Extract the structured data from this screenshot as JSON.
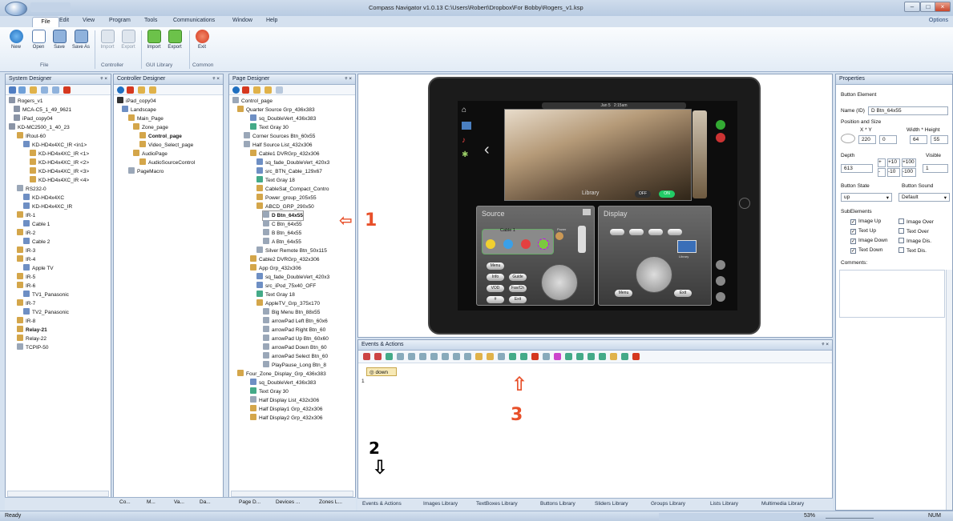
{
  "window": {
    "title": "Compass Navigator v1.0.13 C:\\Users\\Robert\\Dropbox\\For Bobby\\Rogers_v1.ksp",
    "options": "Options"
  },
  "menu": [
    "File",
    "Edit",
    "View",
    "Program",
    "Tools",
    "Communications",
    "Window",
    "Help"
  ],
  "ribbon": {
    "buttons": [
      {
        "label": "New"
      },
      {
        "label": "Open"
      },
      {
        "label": "Save"
      },
      {
        "label": "Save As"
      },
      {
        "label": "Import"
      },
      {
        "label": "Export"
      },
      {
        "label": "Import"
      },
      {
        "label": "Export"
      },
      {
        "label": "Exit"
      }
    ],
    "groups": [
      "File",
      "Controller",
      "GUI Library",
      "Common"
    ]
  },
  "system_designer": {
    "title": "System Designer",
    "pin": "2 ×",
    "items": [
      {
        "label": "Rogers_v1"
      },
      {
        "label": "MCA-C5_1_49_9621"
      },
      {
        "label": "iPad_copy04"
      },
      {
        "label": "KD-MC2500_1_40_23"
      },
      {
        "label": "IRout-60"
      },
      {
        "label": "KD-HD4x4XC_IR <in1>"
      },
      {
        "label": "KD-HD4x4XC_IR <1>"
      },
      {
        "label": "KD-HD4x4XC_IR <2>"
      },
      {
        "label": "KD-HD4x4XC_IR <3>"
      },
      {
        "label": "KD-HD4x4XC_IR <4>"
      },
      {
        "label": "RS232-0"
      },
      {
        "label": "KD-HD4x4XC"
      },
      {
        "label": "KD-HD4x4XC_IR"
      },
      {
        "label": "IR-1"
      },
      {
        "label": "Cable 1"
      },
      {
        "label": "IR-2"
      },
      {
        "label": "Cable 2"
      },
      {
        "label": "IR-3"
      },
      {
        "label": "IR-4"
      },
      {
        "label": "Apple TV"
      },
      {
        "label": "IR-5"
      },
      {
        "label": "IR-6"
      },
      {
        "label": "TV1_Panasonic"
      },
      {
        "label": "IR-7"
      },
      {
        "label": "TV2_Panasonic"
      },
      {
        "label": "IR-8"
      },
      {
        "label": "Relay-21"
      },
      {
        "label": "Relay-22"
      },
      {
        "label": "TCPIP-50"
      }
    ],
    "footer_tabs": [
      "Co...",
      "M...",
      "Va...",
      "Da..."
    ]
  },
  "controller_designer": {
    "title": "Controller Designer",
    "items": [
      {
        "label": "iPad_copy04"
      },
      {
        "label": "Landscape"
      },
      {
        "label": "Main_Page"
      },
      {
        "label": "Zone_page"
      },
      {
        "label": "Control_page"
      },
      {
        "label": "Video_Select_page"
      },
      {
        "label": "AudioPage"
      },
      {
        "label": "AudioSourceControl"
      },
      {
        "label": "PageMacro"
      }
    ]
  },
  "page_designer": {
    "title": "Page Designer",
    "items": [
      {
        "label": "Control_page"
      },
      {
        "label": "Quarter Source Grp_436x383"
      },
      {
        "label": "sq_DoubleVert_436x383"
      },
      {
        "label": "Text Gray 30"
      },
      {
        "label": "Corner Sources Btn_60x55"
      },
      {
        "label": "Half Source List_432x306"
      },
      {
        "label": "Cable1 DVRGrp_432x306"
      },
      {
        "label": "sq_fade_DoubleVert_420x3"
      },
      {
        "label": "src_BTN_Cable_129x67"
      },
      {
        "label": "Text Gray 18"
      },
      {
        "label": "CableSat_Compact_Contro"
      },
      {
        "label": "Power_group_205x55"
      },
      {
        "label": "ABCD_GRP_290x50"
      },
      {
        "label": "D Btn_64x55"
      },
      {
        "label": "C Btn_64x55"
      },
      {
        "label": "B Btn_64x55"
      },
      {
        "label": "A Btn_64x55"
      },
      {
        "label": "Silver Remote Btn_50x115"
      },
      {
        "label": "Cable2 DVRGrp_432x306"
      },
      {
        "label": "App Grp_432x306"
      },
      {
        "label": "sq_fade_DoubleVert_420x3"
      },
      {
        "label": "src_iPod_75x40_OFF"
      },
      {
        "label": "Text Gray 18"
      },
      {
        "label": "AppleTV_Grp_375x170"
      },
      {
        "label": "Big Menu Btn_88x55"
      },
      {
        "label": "arrowPad Left Btn_60x6"
      },
      {
        "label": "arrowPad Right Btn_60"
      },
      {
        "label": "arrowPad Up Btn_60x60"
      },
      {
        "label": "arrowPad Down Btn_60"
      },
      {
        "label": "arrowPad Select Btn_60"
      },
      {
        "label": "PlayPause_Long Btn_8"
      },
      {
        "label": "Four_Zone_Display_Grp_436x383"
      },
      {
        "label": "sq_DoubleVert_436x383"
      },
      {
        "label": "Text Gray 30"
      },
      {
        "label": "Half Display List_432x306"
      },
      {
        "label": "Half Display1 Grp_432x306"
      },
      {
        "label": "Half Display2 Grp_432x306"
      }
    ],
    "footer_tabs": [
      "Page D...",
      "Devices ...",
      "Zones L..."
    ]
  },
  "ipad": {
    "status_time": "Jan 5",
    "status_clock": "2:15am",
    "photo_label": "Library",
    "off": "OFF",
    "on": "ON",
    "side_labels": [
      "Home",
      "Video",
      "Music",
      "Settings"
    ],
    "source": {
      "title": "Source",
      "cable": "Cable 1",
      "buttons": [
        "Menu",
        "Info",
        "Guide",
        "VOD",
        "Fav/Ch",
        "#",
        "Exit"
      ],
      "power": "Power"
    },
    "display": {
      "title": "Display",
      "tv": "Library",
      "buttons": [
        "Menu",
        "Exit"
      ]
    }
  },
  "events": {
    "title": "Events & Actions",
    "tab": "down",
    "line": "1"
  },
  "bottom_tabs": [
    "Events & Actions",
    "Images Library",
    "TextBoxes Library",
    "Buttons Library",
    "Sliders Library",
    "Groups Library",
    "Lists Library",
    "Multimedia Library"
  ],
  "properties": {
    "title": "Properties",
    "section": "Button Element",
    "name_label": "Name (ID)",
    "name_value": "D Btn_64x55",
    "pos_label": "Position and Size",
    "xy_label": "X * Y",
    "wh_label": "Width * Height",
    "x": "220",
    "y": "0",
    "w": "64",
    "h": "55",
    "depth_label": "Depth",
    "depth": "613",
    "visible_label": "Visible",
    "visible": "1",
    "inc": [
      "+",
      "+10",
      "+100",
      "-",
      "-10",
      "-100"
    ],
    "state_label": "Button State",
    "state": "up",
    "sound_label": "Button Sound",
    "sound": "Default",
    "sub_label": "SubElements",
    "subs": [
      {
        "label": "Image Up",
        "checked": true
      },
      {
        "label": "Image Over",
        "checked": false
      },
      {
        "label": "Text Up",
        "checked": true
      },
      {
        "label": "Text Over",
        "checked": false
      },
      {
        "label": "Image Down",
        "checked": true
      },
      {
        "label": "Image Dis.",
        "checked": false
      },
      {
        "label": "Text Down",
        "checked": true
      },
      {
        "label": "Text Dis.",
        "checked": false
      }
    ],
    "comments_label": "Comments:"
  },
  "status": {
    "left": "Ready",
    "zoom": "53%",
    "num": "NUM"
  },
  "annotations": {
    "a1": "1",
    "a2": "2",
    "a3": "3",
    "color": "#e8502a"
  }
}
